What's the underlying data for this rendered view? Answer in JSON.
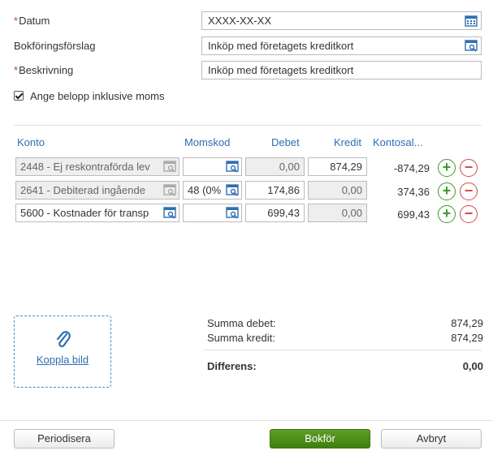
{
  "form": {
    "datum_label": "Datum",
    "datum_value": "XXXX-XX-XX",
    "forslag_label": "Bokföringsförslag",
    "forslag_value": "Inköp med företagets kreditkort",
    "beskrivning_label": "Beskrivning",
    "beskrivning_value": "Inköp med företagets kreditkort",
    "required_marker": "*",
    "incl_vat_label": "Ange belopp inklusive moms",
    "incl_vat_checked": true
  },
  "table": {
    "headers": {
      "konto": "Konto",
      "momskod": "Momskod",
      "debet": "Debet",
      "kredit": "Kredit",
      "saldo": "Kontosal..."
    },
    "rows": [
      {
        "konto": "2448 - Ej reskontraförda lev",
        "momskod": "",
        "debet": "0,00",
        "kredit": "874,29",
        "saldo": "-874,29"
      },
      {
        "konto": "2641 - Debiterad ingående",
        "momskod": "48 (0%",
        "debet": "174,86",
        "kredit": "0,00",
        "saldo": "374,36"
      },
      {
        "konto": "5600 - Kostnader för transp",
        "momskod": "",
        "debet": "699,43",
        "kredit": "0,00",
        "saldo": "699,43"
      }
    ],
    "add_symbol": "+",
    "remove_symbol": "−"
  },
  "attachment": {
    "label": "Koppla bild",
    "icon": "paperclip-icon"
  },
  "summary": {
    "debet_label": "Summa debet:",
    "debet_value": "874,29",
    "kredit_label": "Summa kredit:",
    "kredit_value": "874,29",
    "diff_label": "Differens:",
    "diff_value": "0,00"
  },
  "buttons": {
    "periodisera": "Periodisera",
    "bokfor": "Bokför",
    "avbryt": "Avbryt"
  },
  "colors": {
    "accent": "#2f6fb2",
    "primary_button": "#4a8a18",
    "add": "#3a9a2a",
    "remove": "#d24a4a",
    "required": "#c0392b"
  }
}
